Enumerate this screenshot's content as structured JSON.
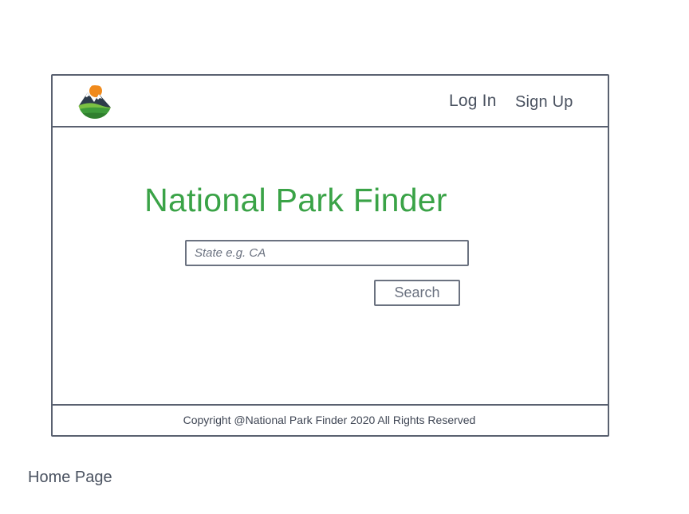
{
  "header": {
    "logo_icon": "mountain-sun-logo-icon",
    "login_label": "Log In",
    "signup_label": "Sign Up"
  },
  "main": {
    "title": "National Park Finder",
    "search": {
      "placeholder": "State e.g. CA",
      "value": ""
    },
    "search_button_label": "Search"
  },
  "footer": {
    "copyright": "Copyright @National Park Finder 2020 All Rights Reserved"
  },
  "caption": "Home Page",
  "colors": {
    "accent": "#3aa347",
    "border": "#5a6170",
    "text": "#4a5260"
  }
}
